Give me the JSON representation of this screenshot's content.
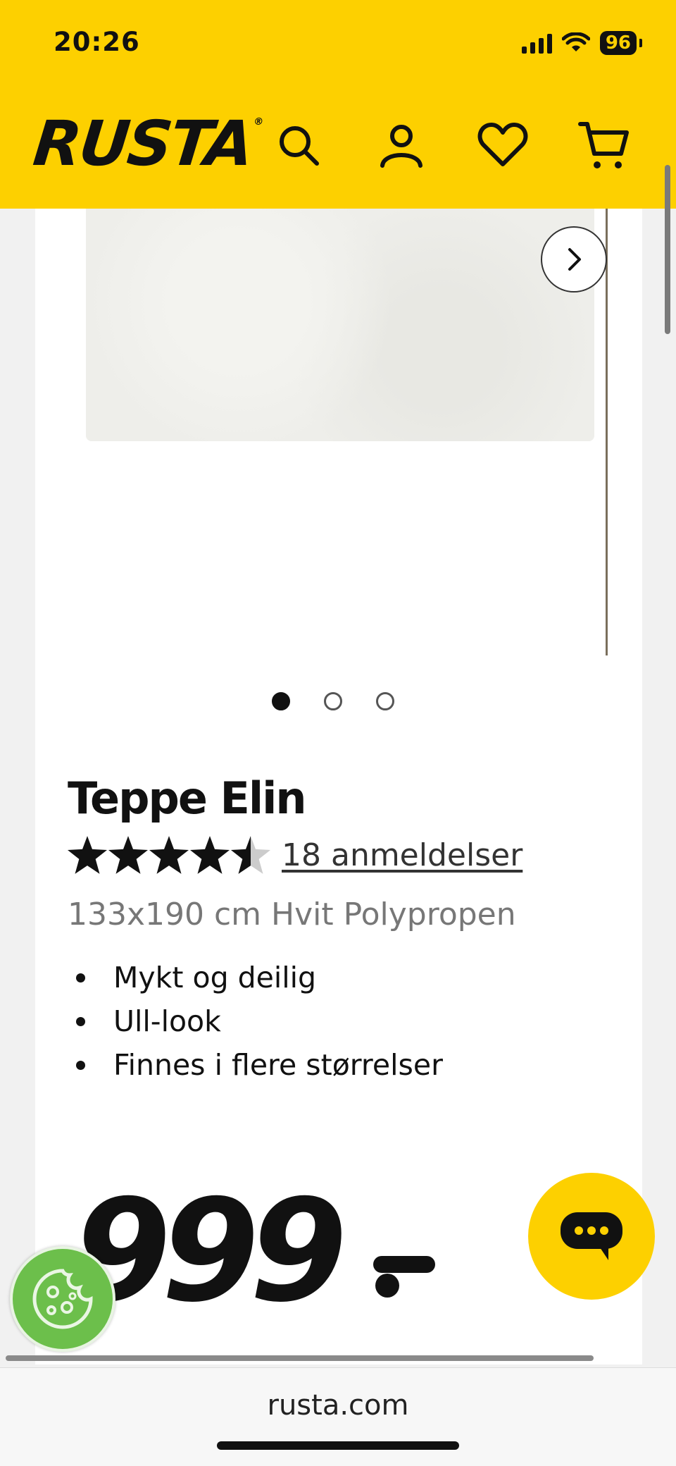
{
  "status_bar": {
    "time": "20:26",
    "battery": "96"
  },
  "header": {
    "logo": "RUSTA",
    "icons": [
      "search-icon",
      "account-icon",
      "heart-icon",
      "cart-icon"
    ],
    "background": "#fdd000"
  },
  "gallery": {
    "slide_count": 3,
    "active_slide": 1
  },
  "product": {
    "title": "Teppe Elin",
    "rating": 4.5,
    "reviews_label": "18 anmeldelser",
    "subtitle": "133x190 cm Hvit Polypropen",
    "features": [
      "Mykt og deilig",
      "Ull-look",
      "Finnes i flere størrelser"
    ],
    "price": "999"
  },
  "browser": {
    "url": "rusta.com"
  }
}
